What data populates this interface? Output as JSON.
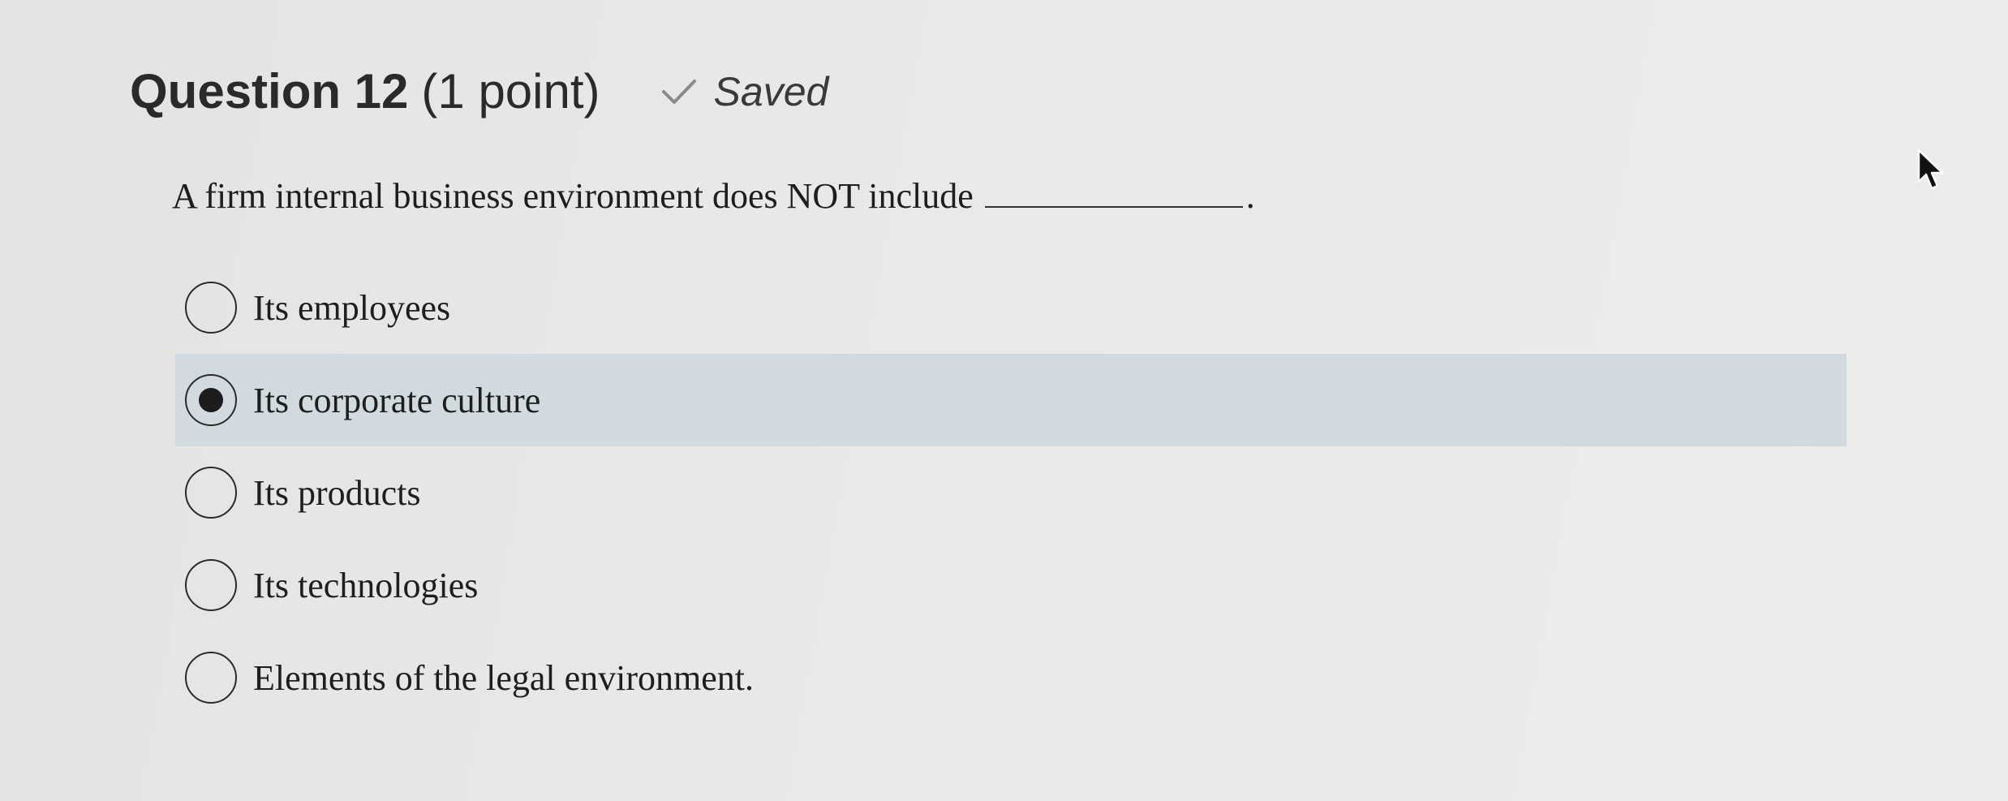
{
  "question": {
    "title": "Question 12",
    "points": "(1 point)",
    "status_icon": "check-icon",
    "status_label": "Saved",
    "prompt": "A firm internal business environment does NOT include",
    "prompt_end": "."
  },
  "options": [
    {
      "label": "Its employees",
      "selected": false
    },
    {
      "label": "Its corporate culture",
      "selected": true
    },
    {
      "label": "Its products",
      "selected": false
    },
    {
      "label": "Its technologies",
      "selected": false
    },
    {
      "label": "Elements of the legal environment.",
      "selected": false
    }
  ],
  "colors": {
    "selected_row": "#d1dbdf",
    "background": "#e9e9e7"
  }
}
